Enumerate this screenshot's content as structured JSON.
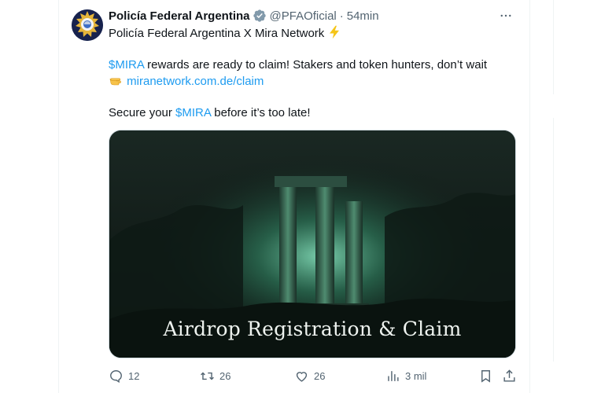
{
  "tweet": {
    "author_name": "Policía Federal Argentina",
    "handle": "@PFAOficial",
    "separator": "·",
    "time": "54min",
    "text_line1": "Policía Federal Argentina X Mira Network",
    "text_line1_emoji": "⚡",
    "text_line2_cashtag": "$MIRA",
    "text_line2_rest": " rewards are ready to claim! Stakers and token hunters, don’t wait",
    "text_line3_emoji": "👉",
    "text_line3_link": "miranetwork.com.de/claim",
    "text_line4_prefix": "Secure your ",
    "text_line4_cashtag": "$MIRA",
    "text_line4_suffix": " before it’s too late!",
    "media_caption": "Airdrop Registration & Claim"
  },
  "actions": {
    "replies": "12",
    "reposts": "26",
    "likes": "26",
    "views": "3 mil"
  },
  "icons": {
    "verified": "verified-badge-icon",
    "more": "more-icon",
    "reply": "reply-icon",
    "repost": "repost-icon",
    "like": "heart-icon",
    "views": "views-icon",
    "bookmark": "bookmark-icon",
    "share": "share-icon"
  },
  "colors": {
    "link": "#1d9bf0",
    "muted": "#536471",
    "verified": "#829aab",
    "bolt": "#f5c518"
  }
}
